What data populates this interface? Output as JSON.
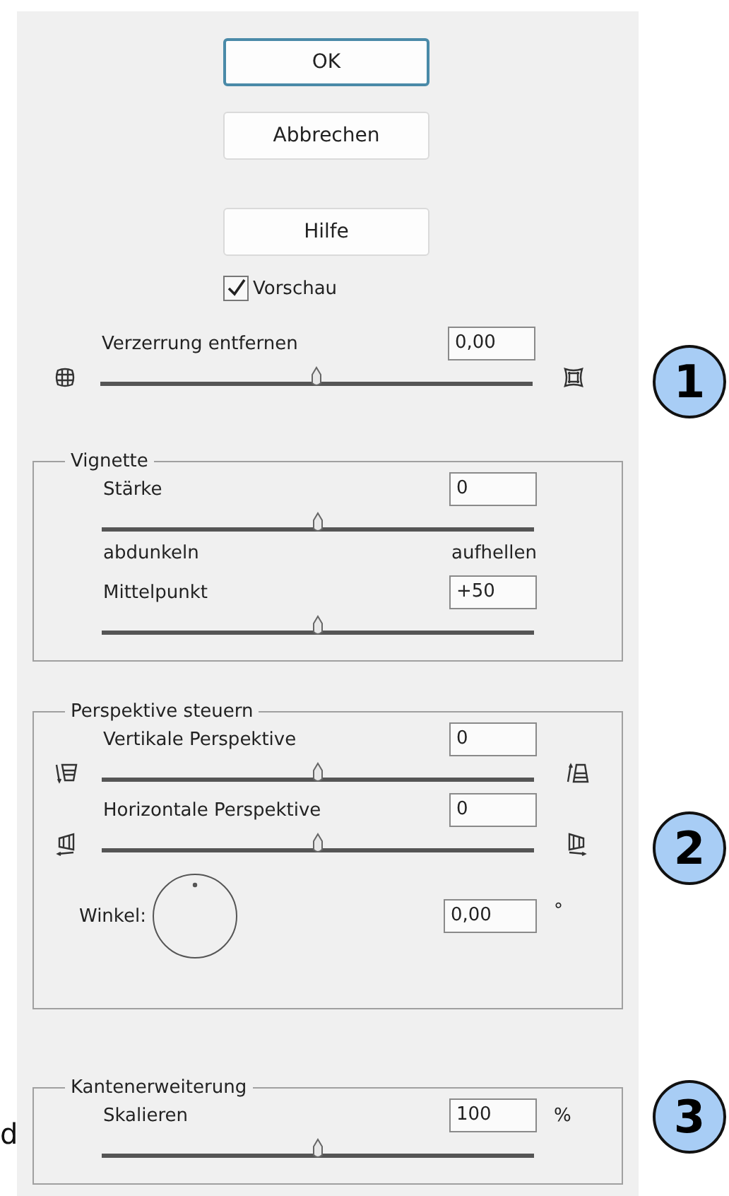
{
  "buttons": [
    {
      "label": "OK",
      "focused": true
    },
    {
      "label": "Abbrechen",
      "focused": false
    },
    {
      "label": "Hilfe",
      "focused": false
    }
  ],
  "preview": {
    "label": "Vorschau",
    "checked": true
  },
  "distortion": {
    "label": "Verzerrung entfernen",
    "value": "0,00",
    "level": 0.5,
    "kind": "barrel_slider"
  },
  "groups": [
    {
      "title": "Vignette",
      "controls": [
        {
          "kind": "slider",
          "label": "Stärke",
          "value": "0",
          "level": 0.5
        },
        {
          "kind": "range_labels",
          "left": "abdunkeln",
          "right": "aufhellen"
        },
        {
          "kind": "slider",
          "label": "Mittelpunkt",
          "value": "+50",
          "level": 0.5
        }
      ]
    },
    {
      "title": "Perspektive steuern",
      "controls": [
        {
          "kind": "vertical_slider",
          "label": "Vertikale Perspektive",
          "value": "0",
          "level": 0.5
        },
        {
          "kind": "horizontal_slider",
          "label": "Horizontale Perspektive",
          "value": "0",
          "level": 0.5
        },
        {
          "kind": "angle",
          "label": "Winkel:",
          "value": "0,00",
          "unit": "°"
        }
      ]
    },
    {
      "title": "Kantenerweiterung",
      "controls": [
        {
          "kind": "slider",
          "label": "Skalieren",
          "value": "100",
          "unit": "%",
          "level": 0.5
        }
      ]
    }
  ],
  "callouts": [
    {
      "number": "1"
    },
    {
      "number": "2"
    },
    {
      "number": "3"
    }
  ],
  "edge_text": "d"
}
